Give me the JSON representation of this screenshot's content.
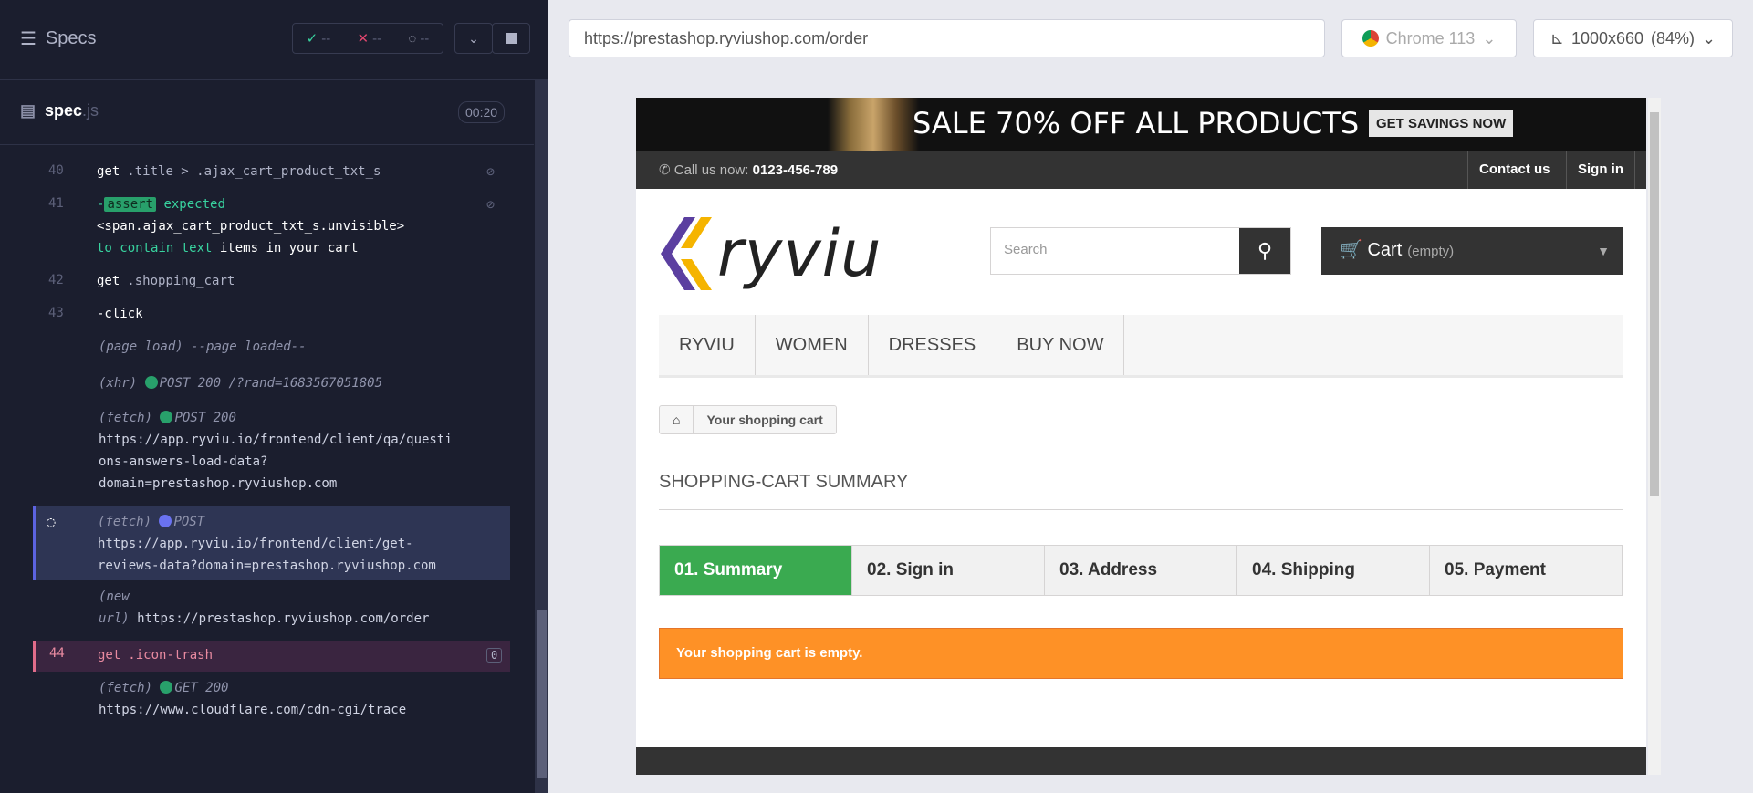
{
  "runner": {
    "title": "Specs",
    "stats": {
      "passed": "--",
      "failed": "--",
      "pending": "--"
    },
    "spec_name": "spec",
    "spec_ext": "js",
    "timer": "00:20"
  },
  "log": [
    {
      "num": "40",
      "cmd": "get",
      "sel": ".title > .ajax_cart_product_txt_s"
    },
    {
      "num": "41",
      "tag": "assert",
      "l1": "expected",
      "l2": "<span.ajax_cart_product_txt_s.unvisible>",
      "l3a": "to contain text",
      "l3b": "items in your cart"
    },
    {
      "num": "42",
      "cmd": "get",
      "sel": ".shopping_cart"
    },
    {
      "num": "43",
      "cmd": "-click"
    },
    {
      "pageload": "(page load)",
      "pageload_text": "--page loaded--"
    },
    {
      "xhr": "(xhr)",
      "xhr_text": "POST 200 /?rand=1683567051805"
    },
    {
      "fetch1": "(fetch)",
      "fetch1_status": "POST 200",
      "fetch1_l1": "https://app.ryviu.io/frontend/client/qa/questi",
      "fetch1_l2": "ons-answers-load-data?",
      "fetch1_l3": "domain=prestashop.ryviushop.com"
    },
    {
      "fetch2": "(fetch)",
      "fetch2_status": "POST",
      "fetch2_l1": "https://app.ryviu.io/frontend/client/get-",
      "fetch2_l2": "reviews-data?domain=prestashop.ryviushop.com"
    },
    {
      "newurl1": "(new",
      "newurl2": "url)",
      "newurl_val": "https://prestashop.ryviushop.com/order"
    },
    {
      "num": "44",
      "cmd": "get",
      "sel": ".icon-trash",
      "badge": "0"
    },
    {
      "fetch3": "(fetch)",
      "fetch3_status": "GET 200",
      "fetch3_l1": "https://www.cloudflare.com/cdn-cgi/trace"
    }
  ],
  "toolbar": {
    "url": "https://prestashop.ryviushop.com/order",
    "browser": "Chrome 113",
    "viewport": "1000x660",
    "zoom": "(84%)"
  },
  "shop": {
    "banner_text": "SALE 70% OFF ALL PRODUCTS",
    "banner_button": "GET SAVINGS NOW",
    "call_label": "Call us now:",
    "phone": "0123-456-789",
    "contact": "Contact us",
    "signin": "Sign in",
    "logo_text": "ryviu",
    "search_placeholder": "Search",
    "cart_label": "Cart",
    "cart_state": "(empty)",
    "menu": [
      "RYVIU",
      "WOMEN",
      "DRESSES",
      "BUY NOW"
    ],
    "breadcrumb": "Your shopping cart",
    "page_title": "SHOPPING-CART SUMMARY",
    "steps": [
      "01. Summary",
      "02. Sign in",
      "03. Address",
      "04. Shipping",
      "05. Payment"
    ],
    "alert": "Your shopping cart is empty."
  },
  "colors": {
    "accent_green": "#3aaa50",
    "alert_orange": "#fe9126",
    "runner_bg": "#1b1e2e"
  }
}
